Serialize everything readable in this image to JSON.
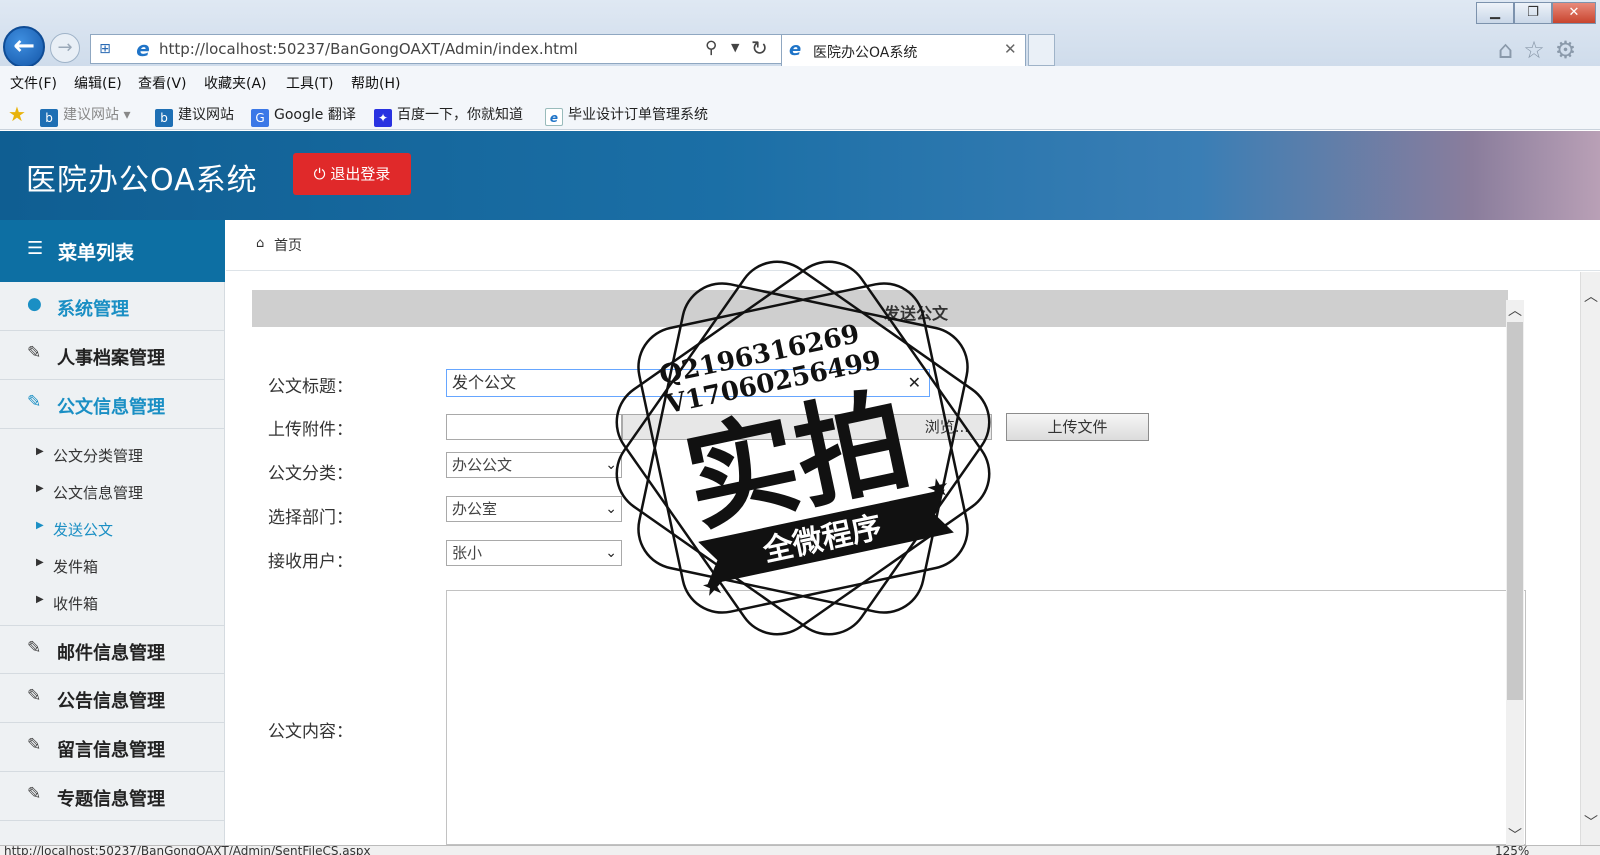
{
  "browser": {
    "url": "http://localhost:50237/BanGongOAXT/Admin/index.html",
    "tab_title": "医院办公OA系统",
    "status_url": "http://localhost:50237/BanGongOAXT/Admin/SentFileCS.aspx",
    "zoom": "125%",
    "menu": [
      "文件(F)",
      "编辑(E)",
      "查看(V)",
      "收藏夹(A)",
      "工具(T)",
      "帮助(H)"
    ],
    "favorites": [
      "建议网站 ▾",
      "建议网站",
      "Google 翻译",
      "百度一下，你就知道",
      "毕业设计订单管理系统"
    ]
  },
  "header": {
    "title": "医院办公OA系统",
    "logout": "退出登录",
    "accent": "#0d6fa3",
    "logout_color": "#e0292a"
  },
  "sidebar": {
    "title": "菜单列表",
    "sections": [
      "系统管理",
      "人事档案管理",
      "公文信息管理",
      "邮件信息管理",
      "公告信息管理",
      "留言信息管理",
      "专题信息管理"
    ],
    "sub_items": [
      "公文分类管理",
      "公文信息管理",
      "发送公文",
      "发件箱",
      "收件箱"
    ],
    "active_section": "公文信息管理",
    "active_sub": "发送公文"
  },
  "breadcrumb": {
    "home": "首页"
  },
  "form": {
    "heading": "发送公文",
    "labels": {
      "title": "公文标题：",
      "attachment": "上传附件：",
      "category": "公文分类：",
      "department": "选择部门：",
      "receiver": "接收用户：",
      "content": "公文内容："
    },
    "values": {
      "title": "发个公文",
      "category": "办公公文",
      "department": "办公室",
      "receiver": "张小"
    },
    "browse_label": "浏览...",
    "upload_label": "上传文件"
  },
  "watermark": {
    "line1": "Q2196316269",
    "line2": "V17060256499",
    "big": "实拍",
    "banner": "全微程序"
  }
}
